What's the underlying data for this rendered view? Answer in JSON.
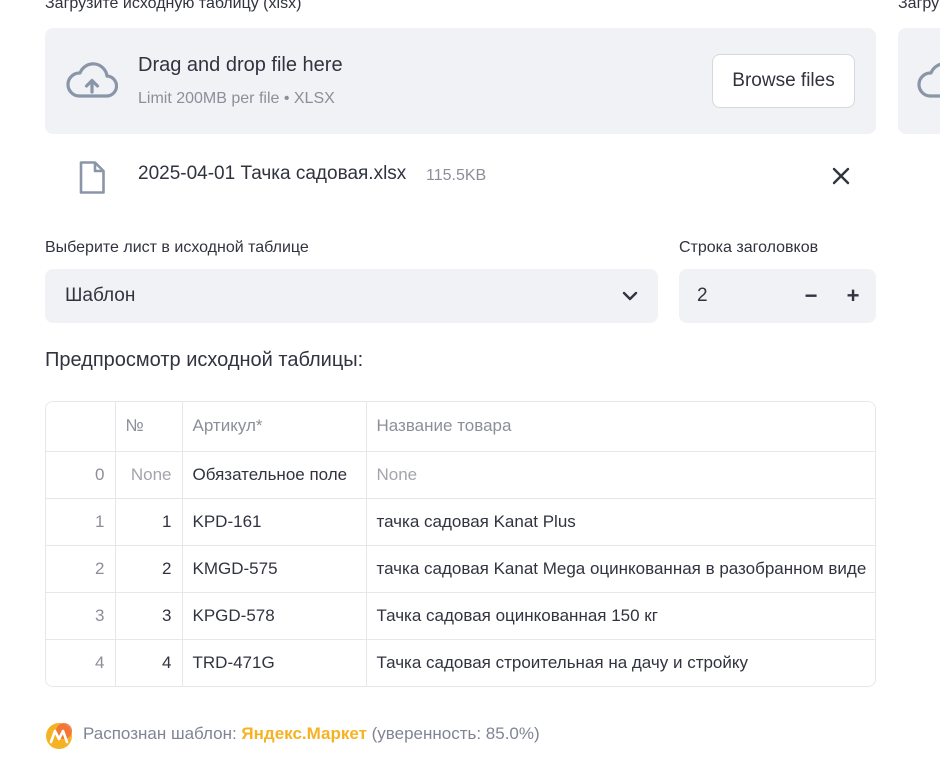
{
  "uploader": {
    "label": "Загрузите исходную таблицу (xlsx)",
    "label_right": "Загру",
    "drop_title": "Drag and drop file here",
    "drop_subtitle": "Limit 200MB per file • XLSX",
    "browse_label": "Browse files",
    "icon": "cloud-upload-icon"
  },
  "file": {
    "name": "2025-04-01 Тачка садовая.xlsx",
    "size": "115.5KB",
    "icon": "file-icon",
    "remove_icon": "close-icon"
  },
  "sheet_select": {
    "label": "Выберите лист в исходной таблице",
    "value": "Шаблон",
    "icon": "chevron-down-icon"
  },
  "header_row": {
    "label": "Строка заголовков",
    "value": "2",
    "minus": "−",
    "plus": "+"
  },
  "preview": {
    "title": "Предпросмотр исходной таблицы:",
    "columns": [
      "",
      "№",
      "Артикул*",
      "Название товара"
    ],
    "rows": [
      {
        "index": "0",
        "no": "None",
        "sku": "Обязательное поле",
        "name": "None"
      },
      {
        "index": "1",
        "no": "1",
        "sku": "KPD-161",
        "name": "тачка садовая Kanat Plus"
      },
      {
        "index": "2",
        "no": "2",
        "sku": "KMGD-575",
        "name": "тачка садовая Kanat Mega оцинкованная в разобранном виде"
      },
      {
        "index": "3",
        "no": "3",
        "sku": "KPGD-578",
        "name": "Тачка садовая оцинкованная 150 кг"
      },
      {
        "index": "4",
        "no": "4",
        "sku": "TRD-471G",
        "name": "Тачка садовая строительная на дачу и стройку"
      }
    ]
  },
  "status": {
    "prefix": "Распознан шаблон: ",
    "brand": "Яндекс.Маркет",
    "suffix": " (уверенность: 85.0%)",
    "icon": "yandex-market-logo-icon"
  },
  "colors": {
    "panel_bg": "#f0f2f6",
    "text": "#31333f",
    "muted": "#8c8f99",
    "brand": "#f5b324"
  }
}
